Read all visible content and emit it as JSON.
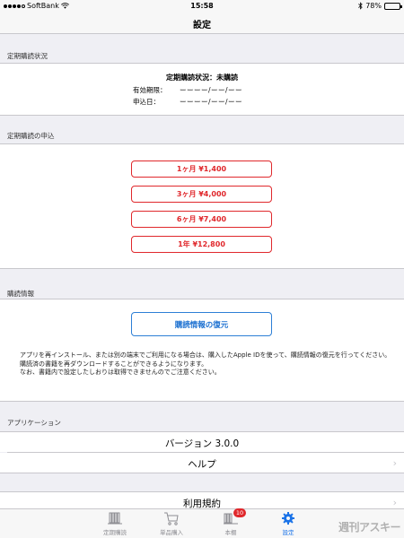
{
  "status_bar": {
    "carrier": "SoftBank",
    "time": "15:58",
    "battery_percent": "78%",
    "battery_level": 0.78,
    "icons": [
      "signal-dots-icon",
      "wifi-icon",
      "bluetooth-icon",
      "battery-icon"
    ]
  },
  "nav": {
    "title": "設定"
  },
  "subscription_status": {
    "header": "定期購読状況",
    "status_text": "定期購読状況：未購読",
    "expiry_label": "有効期限：",
    "expiry_value": "ーーーー/ーー/ーー",
    "applied_label": "申込日：",
    "applied_value": "ーーーー/ーー/ーー"
  },
  "subscription_apply": {
    "header": "定期購読の申込",
    "plans": [
      {
        "label": "1ヶ月 ¥1,400"
      },
      {
        "label": "3ヶ月 ¥4,000"
      },
      {
        "label": "6ヶ月 ¥7,400"
      },
      {
        "label": "1年 ¥12,800"
      }
    ],
    "accent_color": "#e0282c"
  },
  "purchase_info": {
    "header": "購読情報",
    "restore_label": "購読情報の復元",
    "note_lines": [
      "アプリを再インストール、または別の端末でご利用になる場合は、購入したApple IDを使って、購読情報の復元を行ってください。",
      "購読済の書籍を再ダウンロードすることができるようになります。",
      "なお、書籍内で設定したしおりは取得できませんのでご注意ください。"
    ],
    "accent_color": "#2d7fd6"
  },
  "application": {
    "header": "アプリケーション",
    "version": "バージョン  3.0.0",
    "help": "ヘルプ",
    "terms": "利用規約"
  },
  "tab_bar": {
    "tabs": [
      {
        "label": "定期購読",
        "icon": "magazine-rack-icon"
      },
      {
        "label": "単品購入",
        "icon": "cart-icon"
      },
      {
        "label": "本棚",
        "icon": "bookshelf-icon",
        "badge": "10"
      },
      {
        "label": "設定",
        "icon": "gear-icon",
        "active": true
      }
    ],
    "active_color": "#1a73e8"
  },
  "watermark": "週刊アスキー"
}
